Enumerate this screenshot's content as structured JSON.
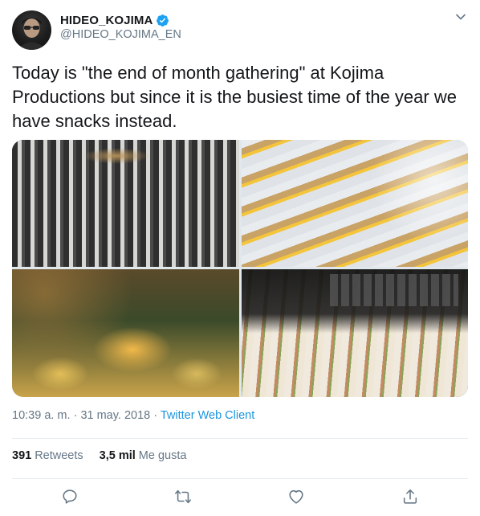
{
  "author": {
    "display_name": "HIDEO_KOJIMA",
    "handle": "@HIDEO_KOJIMA_EN",
    "verified": true
  },
  "tweet": {
    "text": "Today is \"the end of month gathering\" at Kojima Productions but since it is the busiest time of the year we have snacks instead.",
    "photos": [
      "onigiri-baskets-photo",
      "wrapped-pastries-photo",
      "fruit-cups-photo",
      "sandwich-rows-photo"
    ]
  },
  "meta": {
    "time": "10:39 a. m.",
    "separator": " · ",
    "date": "31 may. 2018",
    "source": "Twitter Web Client"
  },
  "stats": {
    "retweets_count": "391",
    "retweets_label": "Retweets",
    "likes_count": "3,5 mil",
    "likes_label": "Me gusta"
  },
  "actions": [
    "reply-icon",
    "retweet-icon",
    "like-icon",
    "share-icon"
  ],
  "colors": {
    "text": "#14171a",
    "muted": "#657786",
    "link": "#1b95e0",
    "verified": "#1da1f2",
    "divider": "#e6ecf0"
  }
}
